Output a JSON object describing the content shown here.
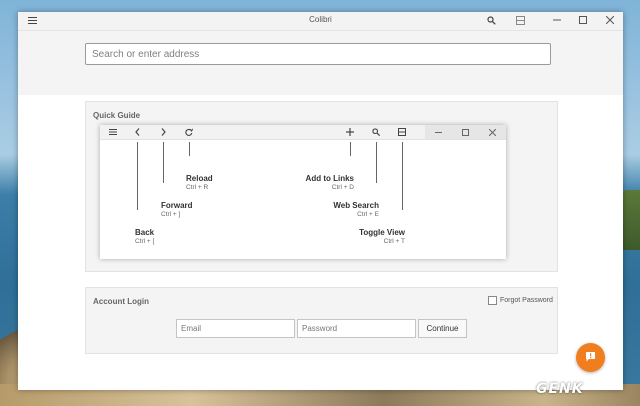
{
  "app": {
    "title": "Colibri"
  },
  "address_bar": {
    "placeholder": "Search or enter address"
  },
  "quick_guide": {
    "title": "Quick Guide",
    "hints": {
      "reload": {
        "label": "Reload",
        "shortcut": "Ctrl + R"
      },
      "forward": {
        "label": "Forward",
        "shortcut": "Ctrl + ]"
      },
      "back": {
        "label": "Back",
        "shortcut": "Ctrl + ["
      },
      "add_to_links": {
        "label": "Add to Links",
        "shortcut": "Ctrl + D"
      },
      "web_search": {
        "label": "Web Search",
        "shortcut": "Ctrl + E"
      },
      "toggle_view": {
        "label": "Toggle View",
        "shortcut": "Ctrl + T"
      }
    }
  },
  "account_login": {
    "title": "Account Login",
    "forgot_password": "Forgot Password",
    "email_placeholder": "Email",
    "password_placeholder": "Password",
    "continue_label": "Continue"
  },
  "watermark": "GENK",
  "colors": {
    "accent": "#f07e1e"
  }
}
